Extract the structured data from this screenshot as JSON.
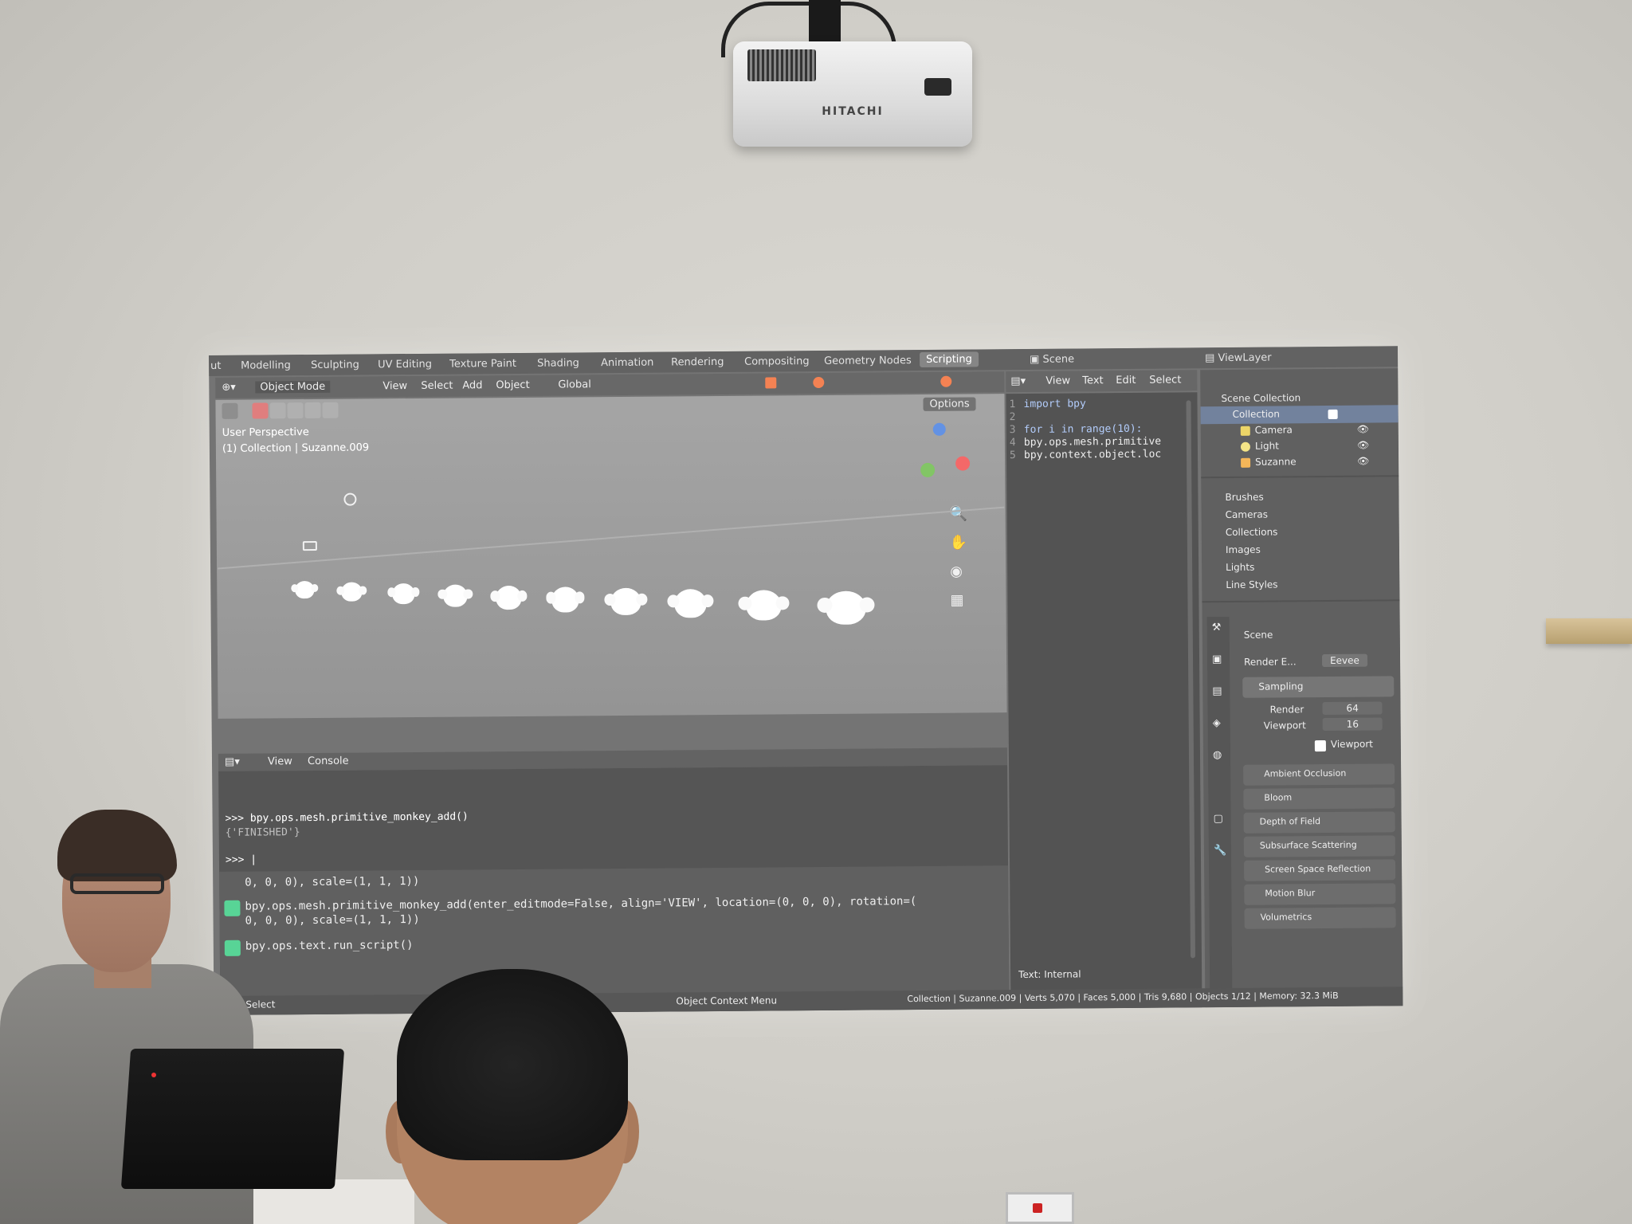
{
  "workspace_tabs": [
    "ut",
    "Modelling",
    "Sculpting",
    "UV Editing",
    "Texture Paint",
    "Shading",
    "Animation",
    "Rendering",
    "Compositing",
    "Geometry Nodes",
    "Scripting"
  ],
  "scene_field": "Scene",
  "viewlayer_field": "ViewLayer",
  "viewport_header": {
    "mode": "Object Mode",
    "menus": [
      "View",
      "Select",
      "Add",
      "Object"
    ],
    "orientation": "Global",
    "options": "Options"
  },
  "viewport_overlay": {
    "line1": "User Perspective",
    "line2": "(1) Collection | Suzanne.009"
  },
  "text_editor": {
    "menus": [
      "View",
      "Text",
      "Edit",
      "Select"
    ],
    "lines": [
      {
        "n": "1",
        "code": "import bpy"
      },
      {
        "n": "2",
        "code": ""
      },
      {
        "n": "3",
        "code": "for i in range(10):"
      },
      {
        "n": "4",
        "code": "    bpy.ops.mesh.primitive"
      },
      {
        "n": "5",
        "code": "    bpy.context.object.loc"
      }
    ],
    "footer": "Text: Internal"
  },
  "outliner": {
    "items": [
      "Scene Collection",
      "Collection",
      "Camera",
      "Light",
      "Suzanne"
    ]
  },
  "blend_data": {
    "items": [
      "Brushes",
      "Cameras",
      "Collections",
      "Images",
      "Lights",
      "Line Styles"
    ]
  },
  "properties": {
    "context": "Scene",
    "render_engine_label": "Render E...",
    "render_engine": "Eevee",
    "sampling": "Sampling",
    "render_label": "Render",
    "render_value": "64",
    "viewport_label": "Viewport",
    "viewport_value": "16",
    "viewport_checkbox": "Viewport",
    "panels": [
      "Ambient Occlusion",
      "Bloom",
      "Depth of Field",
      "Subsurface Scattering",
      "Screen Space Reflection",
      "Motion Blur",
      "Volumetrics"
    ]
  },
  "console": {
    "menus": [
      "View",
      "Console"
    ],
    "lines": [
      ">>> bpy.ops.mesh.primitive_monkey_add()",
      "{'FINISHED'}",
      ">>> |"
    ],
    "info": [
      "0, 0, 0), scale=(1, 1, 1))",
      "bpy.ops.mesh.primitive_monkey_add(enter_editmode=False, align='VIEW', location=(0, 0, 0), rotation=(",
      "0, 0, 0), scale=(1, 1, 1))",
      "bpy.ops.text.run_script()"
    ]
  },
  "statusbar": {
    "left": "Select",
    "middle": "Object Context Menu",
    "right": "Collection | Suzanne.009 | Verts 5,070 | Faces 5,000 | Tris 9,680 | Objects 1/12 | Memory: 32.3 MiB"
  },
  "projector_brand": "HITACHI",
  "colors": {
    "active_tab": "#6e6e6e",
    "accent_blue": "#4a7bd0",
    "checkbox": "#ffffff"
  }
}
